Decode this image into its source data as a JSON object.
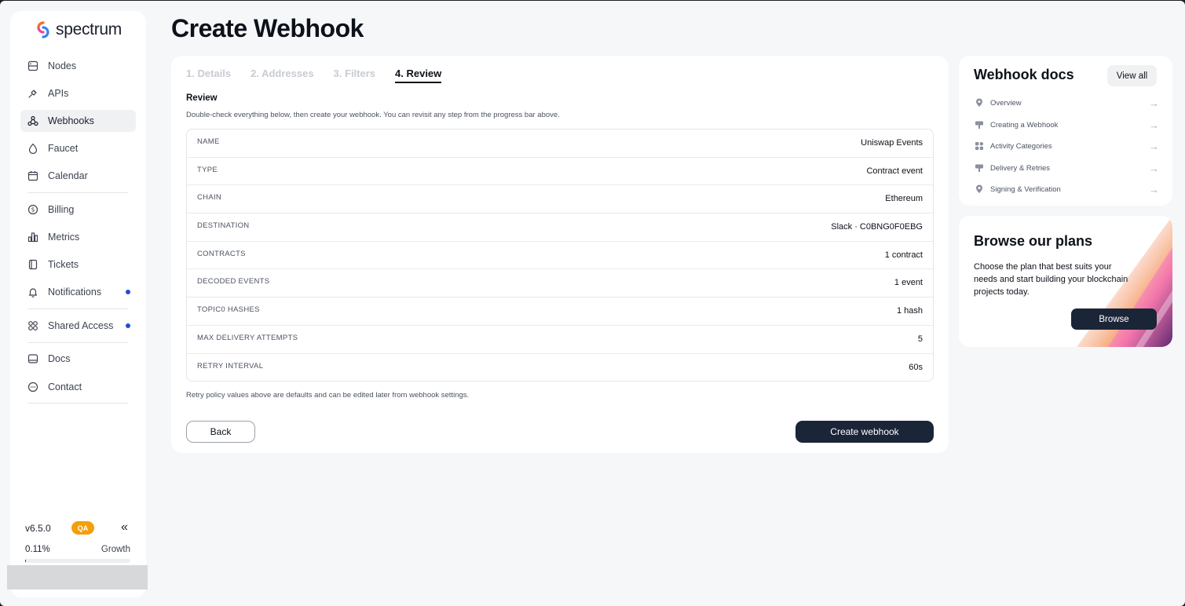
{
  "app": {
    "name": "spectrum"
  },
  "sidebar": {
    "items": [
      {
        "label": "Nodes",
        "icon": "server-icon"
      },
      {
        "label": "APIs",
        "icon": "plug-icon"
      },
      {
        "label": "Webhooks",
        "icon": "webhook-icon",
        "active": true
      },
      {
        "label": "Faucet",
        "icon": "droplet-icon"
      },
      {
        "label": "Calendar",
        "icon": "calendar-icon"
      },
      {
        "label": "Billing",
        "icon": "dollar-icon"
      },
      {
        "label": "Metrics",
        "icon": "bar-chart-icon"
      },
      {
        "label": "Tickets",
        "icon": "ticket-icon"
      },
      {
        "label": "Notifications",
        "icon": "bell-icon",
        "dot": true
      },
      {
        "label": "Shared Access",
        "icon": "grid-icon",
        "dot": true
      },
      {
        "label": "Docs",
        "icon": "book-icon"
      },
      {
        "label": "Contact",
        "icon": "chat-icon"
      }
    ],
    "footer": {
      "version": "v6.5.0",
      "env_badge": "QA",
      "collapse_glyph": "«",
      "usage_percent": "0.11%",
      "usage_fraction": 0.0011,
      "plan": "Growth"
    }
  },
  "page": {
    "title": "Create Webhook"
  },
  "wizard": {
    "steps": [
      "1. Details",
      "2. Addresses",
      "3. Filters",
      "4. Review"
    ],
    "active_step": 3,
    "section_title": "Review",
    "section_desc": "Double-check everything below, then create your webhook. You can revisit any step from the progress bar above.",
    "rows": [
      {
        "key": "NAME",
        "value": "Uniswap Events"
      },
      {
        "key": "TYPE",
        "value": "Contract event"
      },
      {
        "key": "CHAIN",
        "value": "Ethereum"
      },
      {
        "key": "DESTINATION",
        "value": "Slack · C0BNG0F0EBG"
      },
      {
        "key": "CONTRACTS",
        "value": "1 contract"
      },
      {
        "key": "DECODED EVENTS",
        "value": "1 event"
      },
      {
        "key": "TOPIC0 HASHES",
        "value": "1 hash"
      },
      {
        "key": "MAX DELIVERY ATTEMPTS",
        "value": "5"
      },
      {
        "key": "RETRY INTERVAL",
        "value": "60s"
      }
    ],
    "footnote": "Retry policy values above are defaults and can be edited later from webhook settings.",
    "back_label": "Back",
    "create_label": "Create webhook"
  },
  "docs": {
    "title": "Webhook docs",
    "view_all": "View all",
    "links": [
      {
        "label": "Overview",
        "icon": "pin-icon"
      },
      {
        "label": "Creating a Webhook",
        "icon": "sign-icon"
      },
      {
        "label": "Activity Categories",
        "icon": "categories-icon"
      },
      {
        "label": "Delivery & Retries",
        "icon": "sign-icon"
      },
      {
        "label": "Signing & Verification",
        "icon": "pin-icon"
      }
    ],
    "arrow_glyph": "→"
  },
  "plans": {
    "title": "Browse our plans",
    "desc": "Choose the plan that best suits your needs and start building your blockchain projects today.",
    "button": "Browse"
  },
  "colors": {
    "accent_dark": "#1b2538",
    "badge_orange": "#f59e0b",
    "dot_blue": "#1d4ed8",
    "page_bg": "#f6f7f9"
  }
}
